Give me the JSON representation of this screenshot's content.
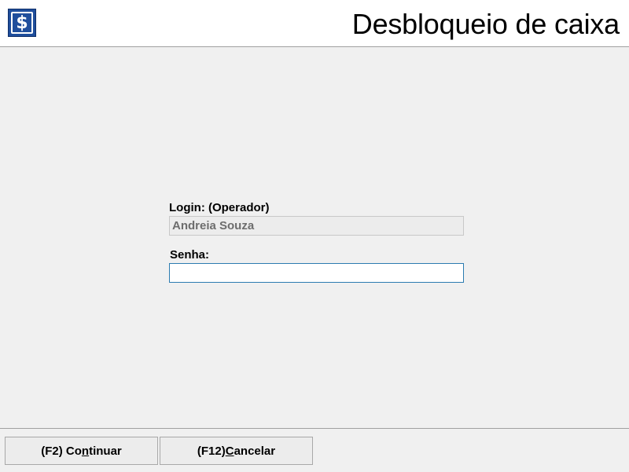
{
  "header": {
    "title": "Desbloqueio de caixa",
    "logo_icon": "dollar-sign-icon",
    "logo_glyph": "$",
    "logo_color": "#1f4e9c"
  },
  "form": {
    "login_label": "Login: (Operador)",
    "login_value": "Andreia Souza",
    "password_label": "Senha:",
    "password_value": ""
  },
  "footer": {
    "continue_button": {
      "prefix": "(F2) Co",
      "mnemonic": "n",
      "suffix": "tinuar"
    },
    "cancel_button": {
      "prefix": "(F12) ",
      "mnemonic": "C",
      "suffix": "ancelar"
    }
  },
  "colors": {
    "background": "#f0f0f0",
    "focus_border": "#2b7bb0"
  }
}
